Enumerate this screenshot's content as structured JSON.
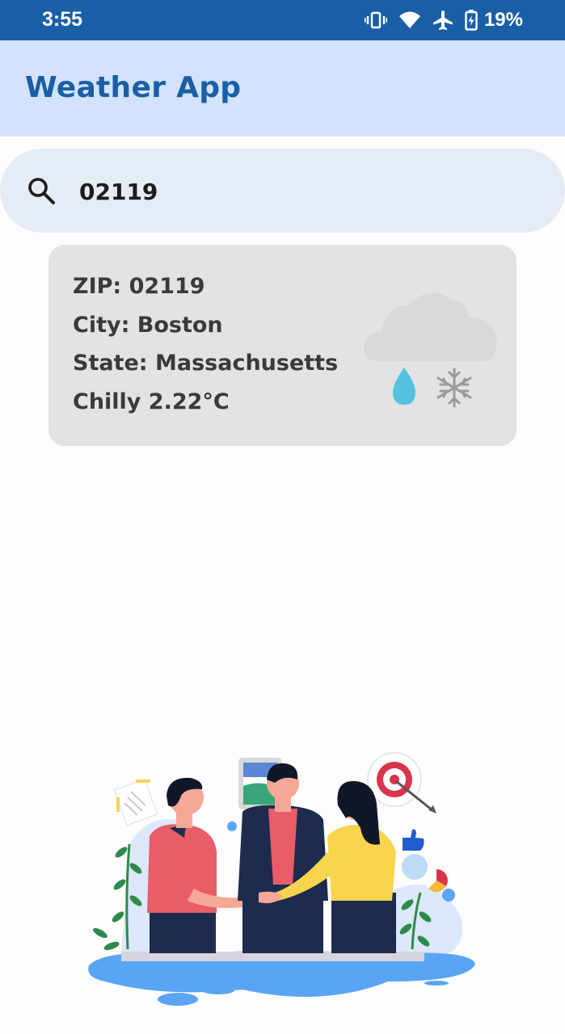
{
  "status_bar": {
    "time": "3:55",
    "battery_percent": "19%",
    "icons": [
      "vibrate-icon",
      "wifi-icon",
      "airplane-icon",
      "battery-charging-icon"
    ]
  },
  "app_bar": {
    "title": "Weather App"
  },
  "search": {
    "value": "02119",
    "icon": "search-icon"
  },
  "weather_card": {
    "zip": "ZIP: 02119",
    "city": "City: Boston",
    "state": "State: Massachusetts",
    "condition": "Chilly 2.22°C",
    "icon": "cloud-rain-snow-icon"
  },
  "colors": {
    "status_bar": "#1a5fa6",
    "app_bar": "#d3e3fd",
    "title": "#1a5fa6",
    "search_bg": "#e5ecf5",
    "card_bg": "#e3e3e3"
  }
}
